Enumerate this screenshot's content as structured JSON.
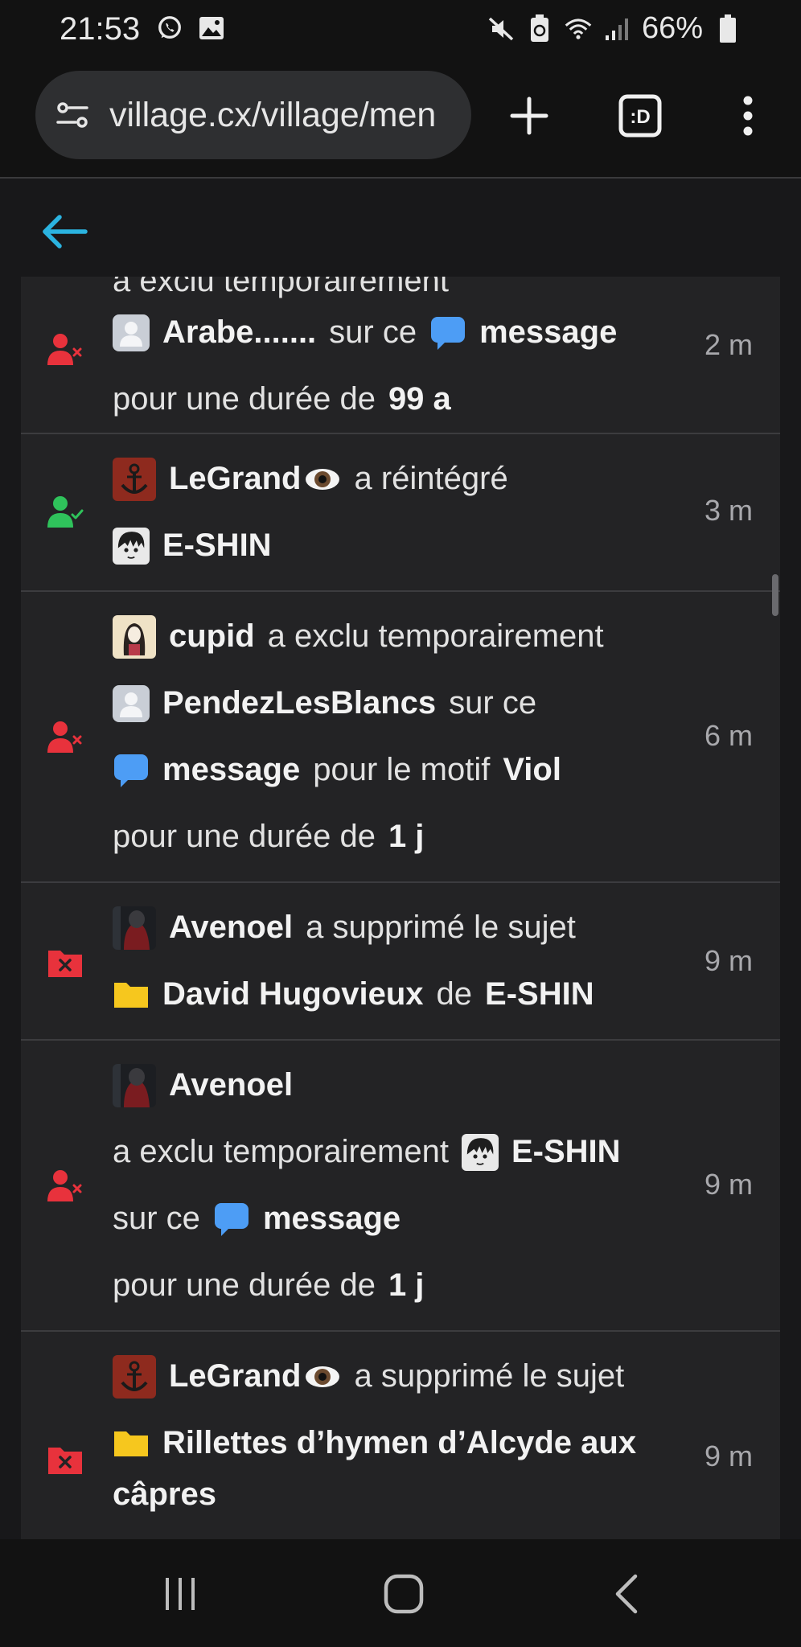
{
  "status_bar": {
    "time": "21:53",
    "battery": "66%"
  },
  "browser": {
    "url": "village.cx/village/men"
  },
  "events": [
    {
      "time": "2 m",
      "kind": "excluded",
      "lead": "a exclu temporairement",
      "target": "Arabe.......",
      "sur_ce": "sur ce",
      "message": "message",
      "duration_prefix": "pour une durée de",
      "duration": "99 a"
    },
    {
      "time": "3 m",
      "kind": "reinstated",
      "actor": "LeGrand",
      "verb": "a réintégré",
      "target": "E-SHIN"
    },
    {
      "time": "6 m",
      "kind": "excluded",
      "actor": "cupid",
      "verb": "a exclu temporairement",
      "target": "PendezLesBlancs",
      "sur_ce": "sur ce",
      "message": "message",
      "motif_prefix": "pour le motif",
      "motif": "Viol",
      "duration_prefix": "pour une durée de",
      "duration": "1 j"
    },
    {
      "time": "9 m",
      "kind": "topic_deleted",
      "actor": "Avenoel",
      "verb": "a supprimé le sujet",
      "topic": "David Hugovieux",
      "de": "de",
      "topic_author": "E-SHIN"
    },
    {
      "time": "9 m",
      "kind": "excluded",
      "actor": "Avenoel",
      "verb": "a exclu temporairement",
      "target": "E-SHIN",
      "sur_ce": "sur ce",
      "message": "message",
      "duration_prefix": "pour une durée de",
      "duration": "1 j"
    },
    {
      "time": "9 m",
      "kind": "topic_deleted",
      "actor": "LeGrand",
      "verb": "a supprimé le sujet",
      "topic_line1": "Rillettes d’hymen d’Alcyde aux",
      "topic_line2": "câpres"
    }
  ],
  "colors": {
    "accent": "#2bb3e0",
    "exclude_red": "#e8323c",
    "reinstate_green": "#2fc25b",
    "message_blue": "#4d9df5",
    "folder_yellow": "#f6c71e"
  },
  "icons": {
    "status": [
      "whatsapp-icon",
      "gallery-icon",
      "mute-icon",
      "battery-saver-icon",
      "wifi-icon",
      "signal-icon",
      "battery-icon"
    ],
    "toolbar": [
      "site-settings-icon",
      "new-tab-icon",
      "tab-switcher-icon",
      "overflow-menu-icon"
    ],
    "nav": [
      "recent-apps-icon",
      "home-icon",
      "back-icon"
    ]
  }
}
